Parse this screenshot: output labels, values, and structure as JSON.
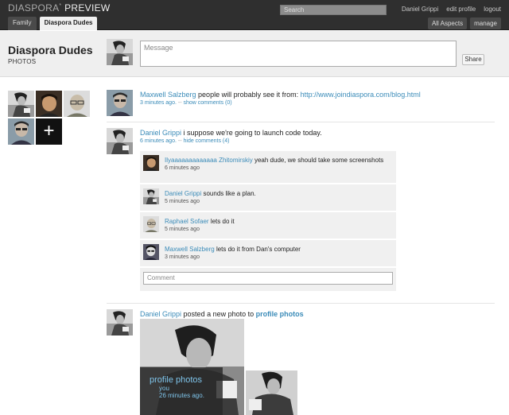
{
  "header": {
    "brand": "DIASPORA",
    "brand_mark": "*",
    "brand_suffix": "PREVIEW",
    "search_placeholder": "Search",
    "user_name": "Daniel Grippi",
    "edit_profile": "edit profile",
    "logout": "logout",
    "tabs": [
      {
        "label": "Family",
        "active": false
      },
      {
        "label": "Diaspora Dudes",
        "active": true
      }
    ],
    "right_tabs": [
      "All Aspects",
      "manage"
    ]
  },
  "page_head": {
    "title": "Diaspora Dudes",
    "subtitle": "PHOTOS",
    "message_placeholder": "Message",
    "share_label": "Share"
  },
  "posts": [
    {
      "author": "Maxwell Salzberg",
      "text": "people will probably see it from:",
      "link": "http://www.joindiaspora.com/blog.html",
      "time": "3 minutes ago.",
      "sep": "--",
      "toggle": "show comments (0)"
    },
    {
      "author": "Daniel Grippi",
      "text": "i suppose we're going to launch code today.",
      "time": "6 minutes ago.",
      "sep": "--",
      "toggle": "hide comments (4)",
      "comments": [
        {
          "author": "Ilyaaaaaaaaaaaaa Zhitomirskiy",
          "text": "yeah dude, we should take some screenshots",
          "time": "6 minutes ago"
        },
        {
          "author": "Daniel Grippi",
          "text": "sounds like a plan.",
          "time": "5 minutes ago"
        },
        {
          "author": "Raphael Sofaer",
          "text": "lets do it",
          "time": "5 minutes ago"
        },
        {
          "author": "Maxwell Salzberg",
          "text": "lets do it from Dan's computer",
          "time": "3 minutes ago"
        }
      ],
      "comment_placeholder": "Comment"
    },
    {
      "author": "Daniel Grippi",
      "text": "posted a new photo to",
      "album": "profile photos",
      "caption_title": "profile photos",
      "caption_by": "you",
      "caption_time": "26 minutes ago."
    }
  ],
  "colors": {
    "link": "#3a8bb8",
    "header_bg": "#2f2f2f",
    "page_head_bg": "#efefef",
    "comment_bg": "#f0f0f0"
  }
}
